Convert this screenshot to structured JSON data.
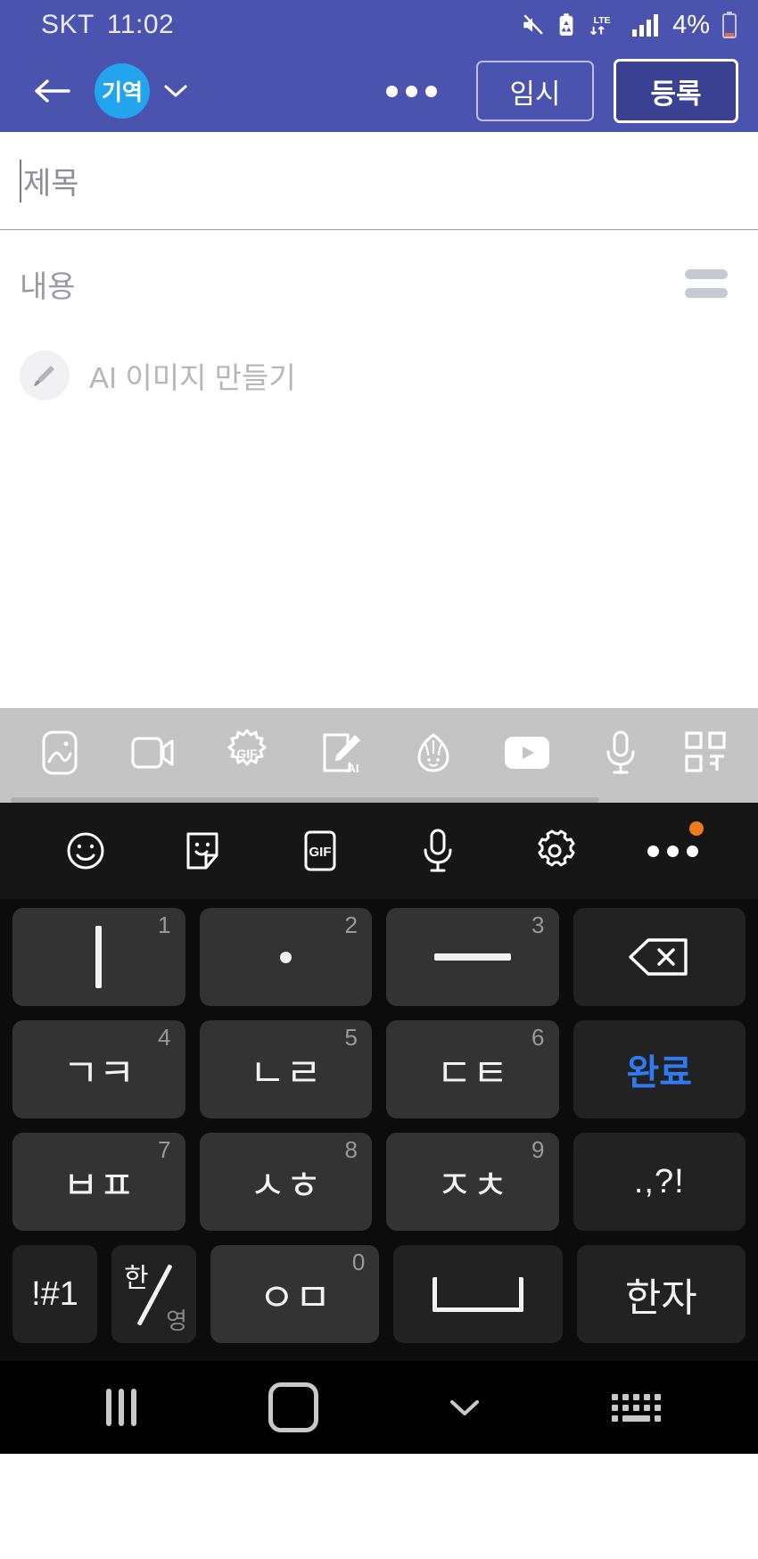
{
  "statusbar": {
    "carrier": "SKT",
    "time": "11:02",
    "battery_percent": "4%",
    "icons": [
      "mute-icon",
      "battery-saver-icon",
      "lte-icon",
      "signal-bars-icon",
      "battery-icon"
    ],
    "network": "LTE"
  },
  "appbar": {
    "back": "back-arrow",
    "profile_chip": "기역",
    "dropdown": "chevron-down",
    "more": "more-options",
    "temp_save_label": "임시",
    "publish_label": "등록"
  },
  "editor": {
    "title_placeholder": "제목",
    "title_value": "",
    "body_placeholder": "내용",
    "body_value": "",
    "align_icon": "align-icon",
    "ai_image_label": "AI 이미지 만들기",
    "ai_icon": "paintbrush-icon"
  },
  "attachbar": {
    "items": [
      {
        "name": "image-icon",
        "label": "사진"
      },
      {
        "name": "video-icon",
        "label": "동영상"
      },
      {
        "name": "gif-icon",
        "label": "GIF"
      },
      {
        "name": "ai-draw-icon",
        "label": "AI"
      },
      {
        "name": "sticker-character-icon",
        "label": "스티커"
      },
      {
        "name": "youtube-icon",
        "label": "동영상 링크"
      },
      {
        "name": "voice-icon",
        "label": "음성"
      },
      {
        "name": "qr-icon",
        "label": "QR"
      }
    ]
  },
  "keyboard": {
    "toolbar": [
      {
        "name": "emoji-icon"
      },
      {
        "name": "sticker-icon"
      },
      {
        "name": "gif-icon",
        "label": "GIF"
      },
      {
        "name": "microphone-icon"
      },
      {
        "name": "settings-gear-icon"
      },
      {
        "name": "more-options-icon",
        "badge": true
      }
    ],
    "rows": [
      [
        {
          "glyph": "ㅣ",
          "num": "1",
          "type": "vline"
        },
        {
          "glyph": "·",
          "num": "2",
          "type": "dot"
        },
        {
          "glyph": "ㅡ",
          "num": "3",
          "type": "dash"
        },
        {
          "glyph": "",
          "num": "",
          "type": "backspace"
        }
      ],
      [
        {
          "glyph": "ㄱㅋ",
          "num": "4",
          "type": "text"
        },
        {
          "glyph": "ㄴㄹ",
          "num": "5",
          "type": "text"
        },
        {
          "glyph": "ㄷㅌ",
          "num": "6",
          "type": "text"
        },
        {
          "glyph": "완료",
          "num": "",
          "type": "done"
        }
      ],
      [
        {
          "glyph": "ㅂㅍ",
          "num": "7",
          "type": "text"
        },
        {
          "glyph": "ㅅㅎ",
          "num": "8",
          "type": "text"
        },
        {
          "glyph": "ㅈㅊ",
          "num": "9",
          "type": "text"
        },
        {
          "glyph": ".,?!",
          "num": "",
          "type": "punct"
        }
      ]
    ],
    "last_row": {
      "symbols": "!#1",
      "lang_top": "한",
      "lang_bottom": "영",
      "zero_glyph": "ㅇㅁ",
      "zero_num": "0",
      "space": "space-bar",
      "hanja": "한자"
    }
  },
  "navbar": {
    "recents": "recents-icon",
    "home": "home-icon",
    "hide_keyboard": "chevron-down-icon",
    "keyboard_switch": "keyboard-switch-icon"
  },
  "colors": {
    "appbar": "#4a54ae",
    "accent_chip": "#22a5ed",
    "done_key": "#2f7bf6",
    "badge": "#ef7c1a",
    "attach_bar": "#c4c4c4",
    "key_bg": "#333333"
  }
}
